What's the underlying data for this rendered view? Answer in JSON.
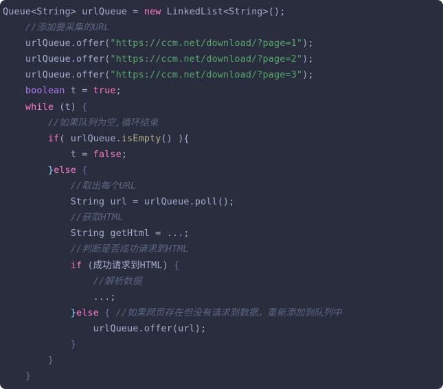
{
  "editor": {
    "language": "java",
    "theme": "material-palenight",
    "background_color": "#292d3e",
    "default_text_color": "#a6accd",
    "comment_color": "#5c6680",
    "string_color": "#57a76a",
    "keyword_color": "#c792ea",
    "keyword_alt_color": "#ff7bc8",
    "punctuation_color": "#89ddff"
  },
  "code": {
    "lines": [
      {
        "indent": 0,
        "tokens": [
          {
            "text": "Queue",
            "style": "t-plain"
          },
          {
            "text": "<",
            "style": "t-plain"
          },
          {
            "text": "String",
            "style": "t-plain"
          },
          {
            "text": "> ",
            "style": "t-plain"
          },
          {
            "text": "urlQueue",
            "style": "t-plain"
          },
          {
            "text": " = ",
            "style": "t-plain"
          },
          {
            "text": "new",
            "style": "t-pink"
          },
          {
            "text": " ",
            "style": "t-plain"
          },
          {
            "text": "LinkedList",
            "style": "t-plain"
          },
          {
            "text": "<",
            "style": "t-plain"
          },
          {
            "text": "String",
            "style": "t-plain"
          },
          {
            "text": ">();",
            "style": "t-plain"
          }
        ]
      },
      {
        "indent": 1,
        "tokens": [
          {
            "text": "//添加要采集的URL",
            "style": "t-cmt"
          }
        ]
      },
      {
        "indent": 1,
        "tokens": [
          {
            "text": "urlQueue",
            "style": "t-plain"
          },
          {
            "text": ".",
            "style": "t-plain"
          },
          {
            "text": "offer",
            "style": "t-plain"
          },
          {
            "text": "(",
            "style": "t-plain"
          },
          {
            "text": "\"https://ccm.net/download/?page=1\"",
            "style": "t-str"
          },
          {
            "text": ");",
            "style": "t-plain"
          }
        ]
      },
      {
        "indent": 1,
        "tokens": [
          {
            "text": "urlQueue",
            "style": "t-plain"
          },
          {
            "text": ".",
            "style": "t-plain"
          },
          {
            "text": "offer",
            "style": "t-plain"
          },
          {
            "text": "(",
            "style": "t-plain"
          },
          {
            "text": "\"https://ccm.net/download/?page=2\"",
            "style": "t-str"
          },
          {
            "text": ");",
            "style": "t-plain"
          }
        ]
      },
      {
        "indent": 1,
        "tokens": [
          {
            "text": "urlQueue",
            "style": "t-plain"
          },
          {
            "text": ".",
            "style": "t-plain"
          },
          {
            "text": "offer",
            "style": "t-plain"
          },
          {
            "text": "(",
            "style": "t-plain"
          },
          {
            "text": "\"https://ccm.net/download/?page=3\"",
            "style": "t-str"
          },
          {
            "text": ");",
            "style": "t-plain"
          }
        ]
      },
      {
        "indent": 1,
        "tokens": [
          {
            "text": "boolean",
            "style": "t-purple"
          },
          {
            "text": " t ",
            "style": "t-plain"
          },
          {
            "text": "= ",
            "style": "t-plain"
          },
          {
            "text": "true",
            "style": "t-pink"
          },
          {
            "text": ";",
            "style": "t-plain"
          }
        ]
      },
      {
        "indent": 1,
        "tokens": [
          {
            "text": "while",
            "style": "t-pink"
          },
          {
            "text": " (t) ",
            "style": "t-plain"
          },
          {
            "text": "{",
            "style": "t-brace"
          }
        ]
      },
      {
        "indent": 2,
        "tokens": [
          {
            "text": "//如果队列为空,循环结束",
            "style": "t-cmt"
          }
        ]
      },
      {
        "indent": 2,
        "tokens": [
          {
            "text": "if",
            "style": "t-pink"
          },
          {
            "text": "( ",
            "style": "t-plain"
          },
          {
            "text": "urlQueue",
            "style": "t-plain"
          },
          {
            "text": ".",
            "style": "t-plain"
          },
          {
            "text": "isEmpty",
            "style": "t-meth"
          },
          {
            "text": "() ){",
            "style": "t-plain"
          }
        ]
      },
      {
        "indent": 3,
        "tokens": [
          {
            "text": "t ",
            "style": "t-plain"
          },
          {
            "text": "= ",
            "style": "t-plain"
          },
          {
            "text": "false",
            "style": "t-pink"
          },
          {
            "text": ";",
            "style": "t-plain"
          }
        ]
      },
      {
        "indent": 2,
        "tokens": [
          {
            "text": "}",
            "style": "t-punc"
          },
          {
            "text": "else",
            "style": "t-pink"
          },
          {
            "text": " ",
            "style": "t-plain"
          },
          {
            "text": "{",
            "style": "t-brace"
          }
        ]
      },
      {
        "indent": 3,
        "tokens": [
          {
            "text": "//取出每个URL",
            "style": "t-cmt"
          }
        ]
      },
      {
        "indent": 3,
        "tokens": [
          {
            "text": "String",
            "style": "t-plain"
          },
          {
            "text": " url ",
            "style": "t-plain"
          },
          {
            "text": "= ",
            "style": "t-plain"
          },
          {
            "text": "urlQueue",
            "style": "t-plain"
          },
          {
            "text": ".",
            "style": "t-plain"
          },
          {
            "text": "poll",
            "style": "t-plain"
          },
          {
            "text": "();",
            "style": "t-plain"
          }
        ]
      },
      {
        "indent": 3,
        "tokens": [
          {
            "text": "//获取HTML",
            "style": "t-cmt"
          }
        ]
      },
      {
        "indent": 3,
        "tokens": [
          {
            "text": "String",
            "style": "t-plain"
          },
          {
            "text": " getHtml ",
            "style": "t-plain"
          },
          {
            "text": "= ",
            "style": "t-plain"
          },
          {
            "text": "...;",
            "style": "t-plain"
          }
        ]
      },
      {
        "indent": 3,
        "tokens": [
          {
            "text": "//判断是否成功请求到HTML",
            "style": "t-cmt"
          }
        ]
      },
      {
        "indent": 3,
        "tokens": [
          {
            "text": "if",
            "style": "t-pink"
          },
          {
            "text": " (成功请求到HTML) ",
            "style": "t-plain"
          },
          {
            "text": "{",
            "style": "t-brace"
          }
        ]
      },
      {
        "indent": 4,
        "tokens": [
          {
            "text": "//解析数据",
            "style": "t-cmt"
          }
        ]
      },
      {
        "indent": 4,
        "tokens": [
          {
            "text": "...;",
            "style": "t-plain"
          }
        ]
      },
      {
        "indent": 3,
        "tokens": [
          {
            "text": "}",
            "style": "t-punc"
          },
          {
            "text": "else",
            "style": "t-pink"
          },
          {
            "text": " ",
            "style": "t-plain"
          },
          {
            "text": "{",
            "style": "t-brace"
          },
          {
            "text": " ",
            "style": "t-plain"
          },
          {
            "text": "//如果网页存在但没有请求到数据，重新添加到队列中",
            "style": "t-cmt"
          }
        ]
      },
      {
        "indent": 4,
        "tokens": [
          {
            "text": "urlQueue",
            "style": "t-plain"
          },
          {
            "text": ".",
            "style": "t-plain"
          },
          {
            "text": "offer",
            "style": "t-plain"
          },
          {
            "text": "(url);",
            "style": "t-plain"
          }
        ]
      },
      {
        "indent": 3,
        "tokens": [
          {
            "text": "}",
            "style": "t-brace"
          }
        ]
      },
      {
        "indent": 2,
        "tokens": [
          {
            "text": "}",
            "style": "t-brace"
          }
        ]
      },
      {
        "indent": 1,
        "tokens": [
          {
            "text": "}",
            "style": "t-brace"
          }
        ]
      }
    ]
  }
}
